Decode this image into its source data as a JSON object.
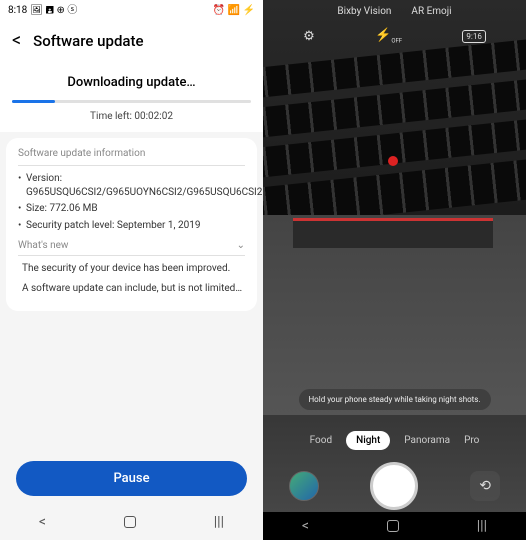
{
  "left": {
    "status": {
      "time": "8:18",
      "icons_left": "🖼 🖪 ⊕ ⓢ",
      "icons_right": "⏰ 📶 ⚡"
    },
    "header": {
      "title": "Software update"
    },
    "download": {
      "title": "Downloading update…",
      "progress_pct": 18,
      "time_left_label": "Time left: 00:02:02"
    },
    "info": {
      "section_header": "Software update information",
      "version_label": "Version: G965USQU6CSI2/G965UOYN6CSI2/G965USQU6CSI2",
      "size_label": "Size: 772.06 MB",
      "patch_label": "Security patch level: September 1, 2019",
      "whatsnew_header": "What's new",
      "whatsnew_line1": "The security of your device has been improved.",
      "whatsnew_line2": "A software update can include, but is not limited…"
    },
    "pause_label": "Pause"
  },
  "right": {
    "top_tabs": {
      "bixby": "Bixby Vision",
      "aremoji": "AR Emoji"
    },
    "top_icons": {
      "settings": "⚙",
      "flash": "⚡",
      "flash_sub": "OFF",
      "aspect": "9:16"
    },
    "toast_text": "Hold your phone steady while taking night shots.",
    "modes": {
      "food": "Food",
      "night": "Night",
      "panorama": "Panorama",
      "pro": "Pro"
    }
  }
}
